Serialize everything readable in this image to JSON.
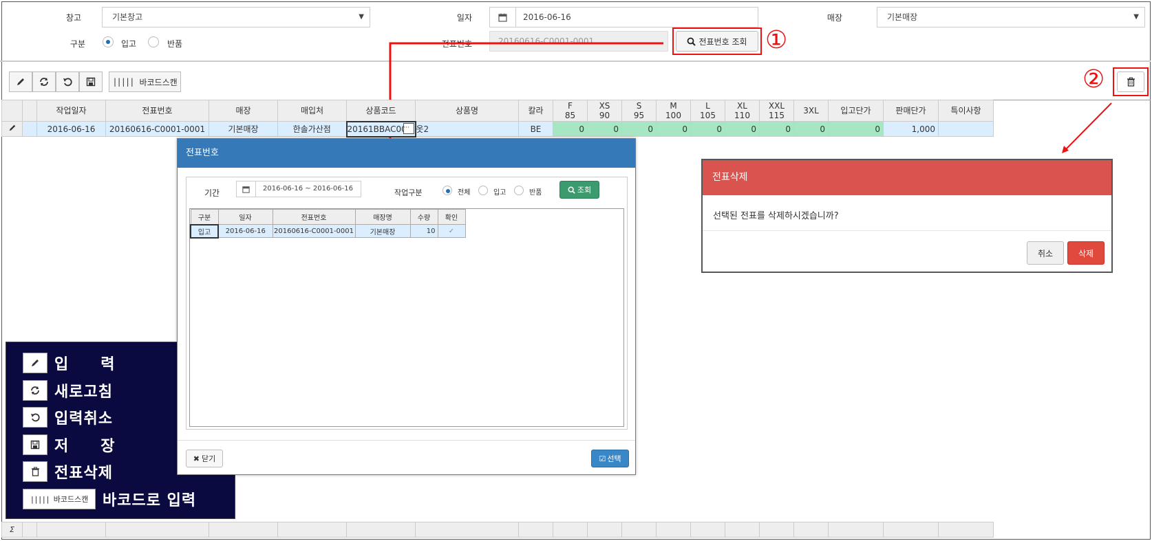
{
  "form": {
    "warehouse_label": "창고",
    "warehouse_value": "기본창고",
    "date_label": "일자",
    "date_value": "2016-06-16",
    "store_label": "매장",
    "store_value": "기본매장",
    "type_label": "구분",
    "type_option_in": "입고",
    "type_option_return": "반품",
    "slip_label": "전표번호",
    "slip_value": "20160616-C0001-0001",
    "slip_search_button": "전표번호 조회"
  },
  "annotations": {
    "one": "①",
    "two": "②"
  },
  "toolbar": {
    "barcode_label": "바코드스캔"
  },
  "grid": {
    "headers": [
      "작업일자",
      "전표번호",
      "매장",
      "매입처",
      "상품코드",
      "상품명",
      "칼라",
      "F\n85",
      "XS\n90",
      "S\n95",
      "M\n100",
      "L\n105",
      "XL\n110",
      "XXL\n115",
      "3XL",
      "입고단가",
      "판매단가",
      "특이사항"
    ],
    "row": {
      "work_date": "2016-06-16",
      "slip_no": "20160616-C0001-0001",
      "store": "기본매장",
      "supplier": "한솔가산점",
      "product_code": "20161BBAC002",
      "product_name": "옷2",
      "color": "BE",
      "qty_f": "0",
      "qty_xs": "0",
      "qty_s": "0",
      "qty_m": "0",
      "qty_l": "0",
      "qty_xl": "0",
      "qty_xxl": "0",
      "qty_3xl": "0",
      "in_price": "0",
      "sale_price": "1,000",
      "note": ""
    },
    "sum_symbol": "Σ"
  },
  "slip_dialog": {
    "title": "전표번호",
    "period_label": "기간",
    "period_value": "2016-06-16 ~ 2016-06-16",
    "work_type_label": "작업구분",
    "opt_all": "전체",
    "opt_in": "입고",
    "opt_return": "반품",
    "search_button": "조회",
    "headers": [
      "구분",
      "일자",
      "전표번호",
      "매장명",
      "수량",
      "확인"
    ],
    "row": {
      "type": "입고",
      "date": "2016-06-16",
      "slip_no": "20160616-C0001-0001",
      "store": "기본매장",
      "qty": "10",
      "check": "✓"
    },
    "close_button": "닫기",
    "select_button": "선택"
  },
  "delete_dialog": {
    "title": "전표삭제",
    "message": "선택된 전표를 삭제하시겠습니까?",
    "cancel_button": "취소",
    "delete_button": "삭제"
  },
  "legend": {
    "input": "입　　력",
    "refresh": "새로고침",
    "cancel_input": "입력취소",
    "save": "저　　장",
    "delete_slip": "전표삭제",
    "barcode_input": "바코드로 입력",
    "barcode_btn": "바코드스캔"
  }
}
